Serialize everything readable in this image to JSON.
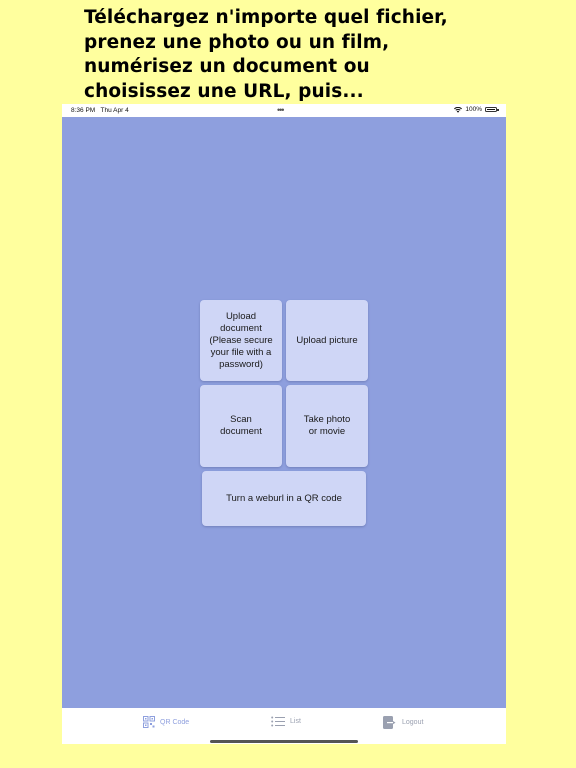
{
  "headline": {
    "line1": "Téléchargez n'importe quel fichier,",
    "line2": "prenez une photo ou un film,",
    "line3": "numérisez un document ou",
    "line4": "choisissez une URL, puis..."
  },
  "status_bar": {
    "time": "8:36 PM",
    "date": "Thu Apr 4",
    "dots": "•••",
    "battery": "100%"
  },
  "actions": {
    "upload_document": "Upload\ndocument\n(Please secure\nyour file with a\npassword)",
    "upload_picture": "Upload picture",
    "scan_document": "Scan\ndocument",
    "take_photo": "Take photo\nor movie",
    "weburl_qr": "Turn a weburl in a QR code"
  },
  "tab_bar": {
    "qr_code": "QR Code",
    "list": "List",
    "logout": "Logout"
  },
  "colors": {
    "page_background": "#ffff9e",
    "app_background": "#8e9fde",
    "button_background": "#cfd6f6",
    "tab_active": "#8e9fde"
  },
  "icons": [
    "wifi-icon",
    "battery-icon",
    "qr-code-icon",
    "list-icon",
    "logout-icon"
  ]
}
